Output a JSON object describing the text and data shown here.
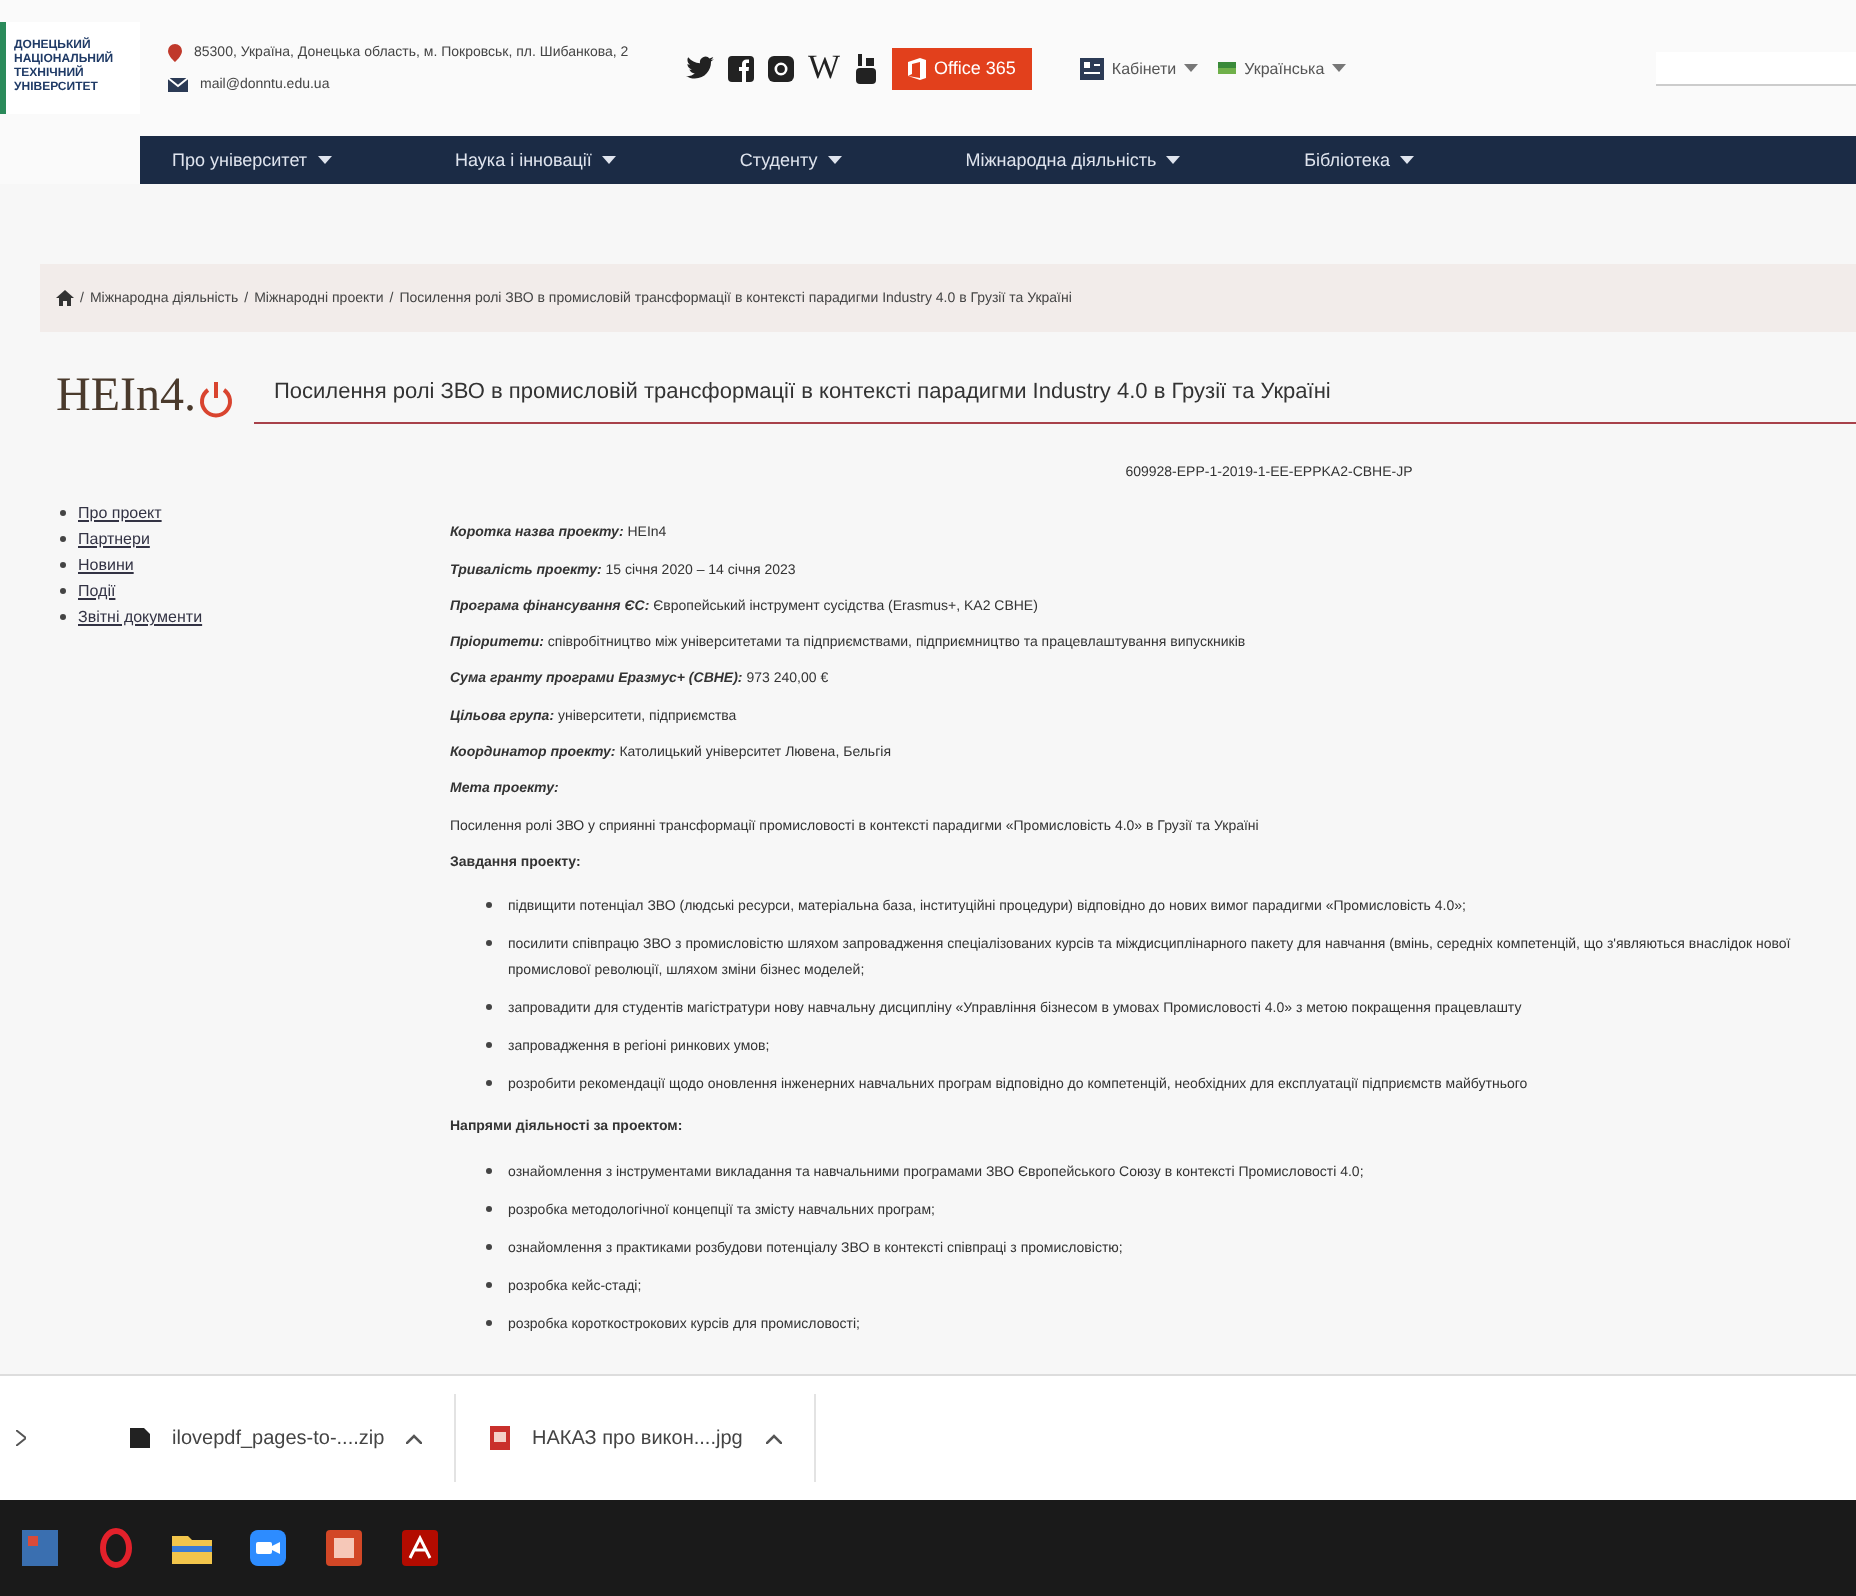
{
  "header": {
    "logo_lines": [
      "ДОНЕЦЬКИЙ",
      "НАЦІОНАЛЬНИЙ",
      "ТЕХНІЧНИЙ",
      "УНІВЕРСИТЕТ"
    ],
    "address": "85300, Україна, Донецька область, м. Покровськ, пл. Шибанкова, 2",
    "email": "mail@donntu.edu.ua",
    "wiki_glyph": "W",
    "office_button": "Office 365",
    "menus": [
      "Кабінети",
      "Українська"
    ]
  },
  "nav": [
    "Про університет",
    "Наука і інновації",
    "Студенту",
    "Міжнародна діяльність",
    "Бібліотека"
  ],
  "breadcrumb_separator": "/",
  "breadcrumb": [
    "Міжнародна діяльність",
    "Міжнародні проекти",
    "Посилення ролі ЗВО в промисловій трансформації в контексті парадигми Industry 4.0 в Грузії та Україні"
  ],
  "project": {
    "logo_text": "HEIn4.",
    "title": "Посилення ролі ЗВО в промисловій трансформації в контексті парадигми Industry 4.0 в Грузії та Україні",
    "code": "609928-EPP-1-2019-1-EE-EPPKA2-CBHE-JP",
    "details": [
      {
        "label": "Коротка назва проекту:",
        "value": "HEIn4"
      },
      {
        "label": "Тривалість проекту:",
        "value": "15 січня 2020 – 14 січня 2023"
      },
      {
        "label": "Програма фінансування ЄС:",
        "value": "Європейський інструмент сусідства (Erasmus+, KA2 CBHE)"
      },
      {
        "label": "Пріоритети:",
        "value": "співробітництво між університетами та підприємствами, підприємництво та працевлаштування випускників"
      },
      {
        "label": "Сума гранту програми Еразмус+ (CBHE):",
        "value": "973 240,00 €"
      },
      {
        "label": "Цільова група:",
        "value": "університети, підприємства"
      },
      {
        "label": "Координатор проекту:",
        "value": "Католицький університет Лювена, Бельгія"
      },
      {
        "label": "Мета проекту:"
      }
    ],
    "goal": "Посилення ролі ЗВО у сприянні трансформації промисловості в контексті парадигми «Промисловість 4.0» в Грузії та Україні",
    "tasks_label": "Завдання проекту:",
    "tasks": [
      "підвищити потенціал ЗВО (людські ресурси, матеріальна база, інституційні процедури) відповідно до нових вимог парадигми «Промисловість 4.0»;",
      "посилити співпрацю ЗВО з промисловістю шляхом запровадження спеціалізованих курсів та міждисциплінарного пакету для навчання (вмінь, середніх компетенцій, що з'являються внаслідок нової промислової революції, шляхом зміни бізнес моделей;",
      "запровадити для студентів магістратури нову навчальну дисципліну «Управління бізнесом в умовах Промисловості 4.0» з метою покращення працевлашту",
      "запровадження в регіоні ринкових умов;",
      "розробити рекомендації щодо оновлення інженерних навчальних програм відповідно до компетенцій, необхідних для експлуатації підприємств майбутнього"
    ],
    "activities_label": "Напрями діяльності за проектом:",
    "activities": [
      "ознайомлення з інструментами викладання та навчальними програмами ЗВО Європейського Союзу в контексті Промисловості 4.0;",
      "розробка методологічної концепції та змісту навчальних програм;",
      "ознайомлення з практиками розбудови потенціалу ЗВО в контексті співпраці з промисловістю;",
      "розробка кейс-стаді;",
      "розробка короткострокових курсів для промисловості;"
    ]
  },
  "sidebar": [
    "Про проект",
    "Партнери",
    "Новини",
    "Події",
    "Звітні документи"
  ],
  "downloads": [
    {
      "name": "ilovepdf_pages-to-....zip",
      "kind": "zip"
    },
    {
      "name": "НАКАЗ про викон....jpg",
      "kind": "jpg"
    }
  ]
}
